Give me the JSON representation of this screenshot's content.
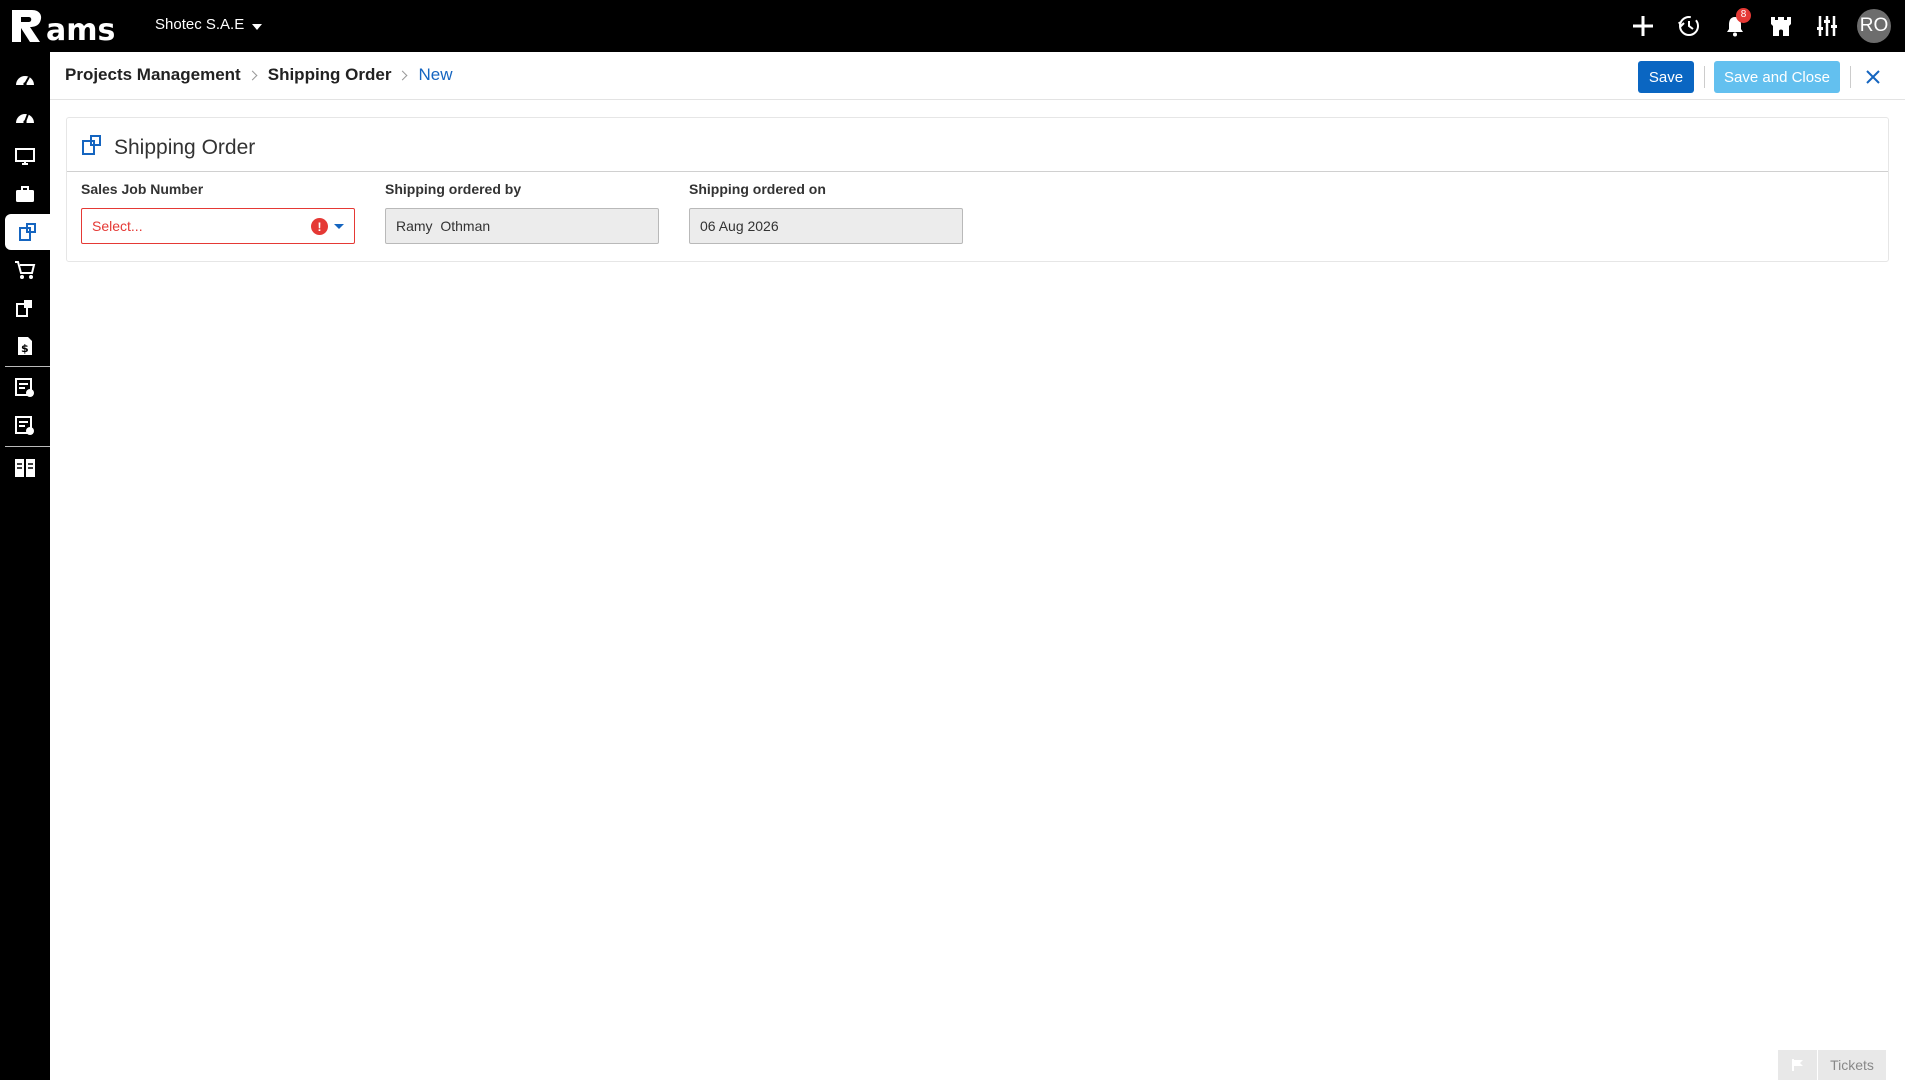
{
  "app": {
    "logo_text": "Rams",
    "company": "Shotec S.A.E"
  },
  "topbar": {
    "icons": [
      "plus-icon",
      "history-icon",
      "bell-icon",
      "castle-icon",
      "sliders-icon"
    ],
    "notifications_count": "8",
    "avatar_initials": "RO"
  },
  "sidebar": {
    "items": [
      "dashboard-icon",
      "dashboard-alt-icon",
      "monitor-icon",
      "briefcase-icon",
      "shipping-order-icon",
      "cart-icon",
      "shipping-alt-icon",
      "invoice-dollar-icon",
      "checklist-icon",
      "checklist-settings-icon",
      "grid-report-icon"
    ],
    "active": "shipping-order-icon"
  },
  "breadcrumb": {
    "items": [
      "Projects Management",
      "Shipping Order"
    ],
    "current": "New"
  },
  "actions": {
    "save_label": "Save",
    "save_close_label": "Save and Close",
    "colors": {
      "primary": "#0a66c2",
      "secondary": "#63c0ef",
      "error": "#e53935"
    }
  },
  "form": {
    "title": "Shipping Order",
    "fields": {
      "sales_job_number": {
        "label": "Sales Job Number",
        "placeholder": "Select..."
      },
      "ordered_by": {
        "label": "Shipping ordered by",
        "value": "Ramy  Othman"
      },
      "ordered_on": {
        "label": "Shipping ordered on",
        "value": "06 Aug 2026"
      }
    }
  },
  "footer": {
    "tickets_label": "Tickets"
  }
}
